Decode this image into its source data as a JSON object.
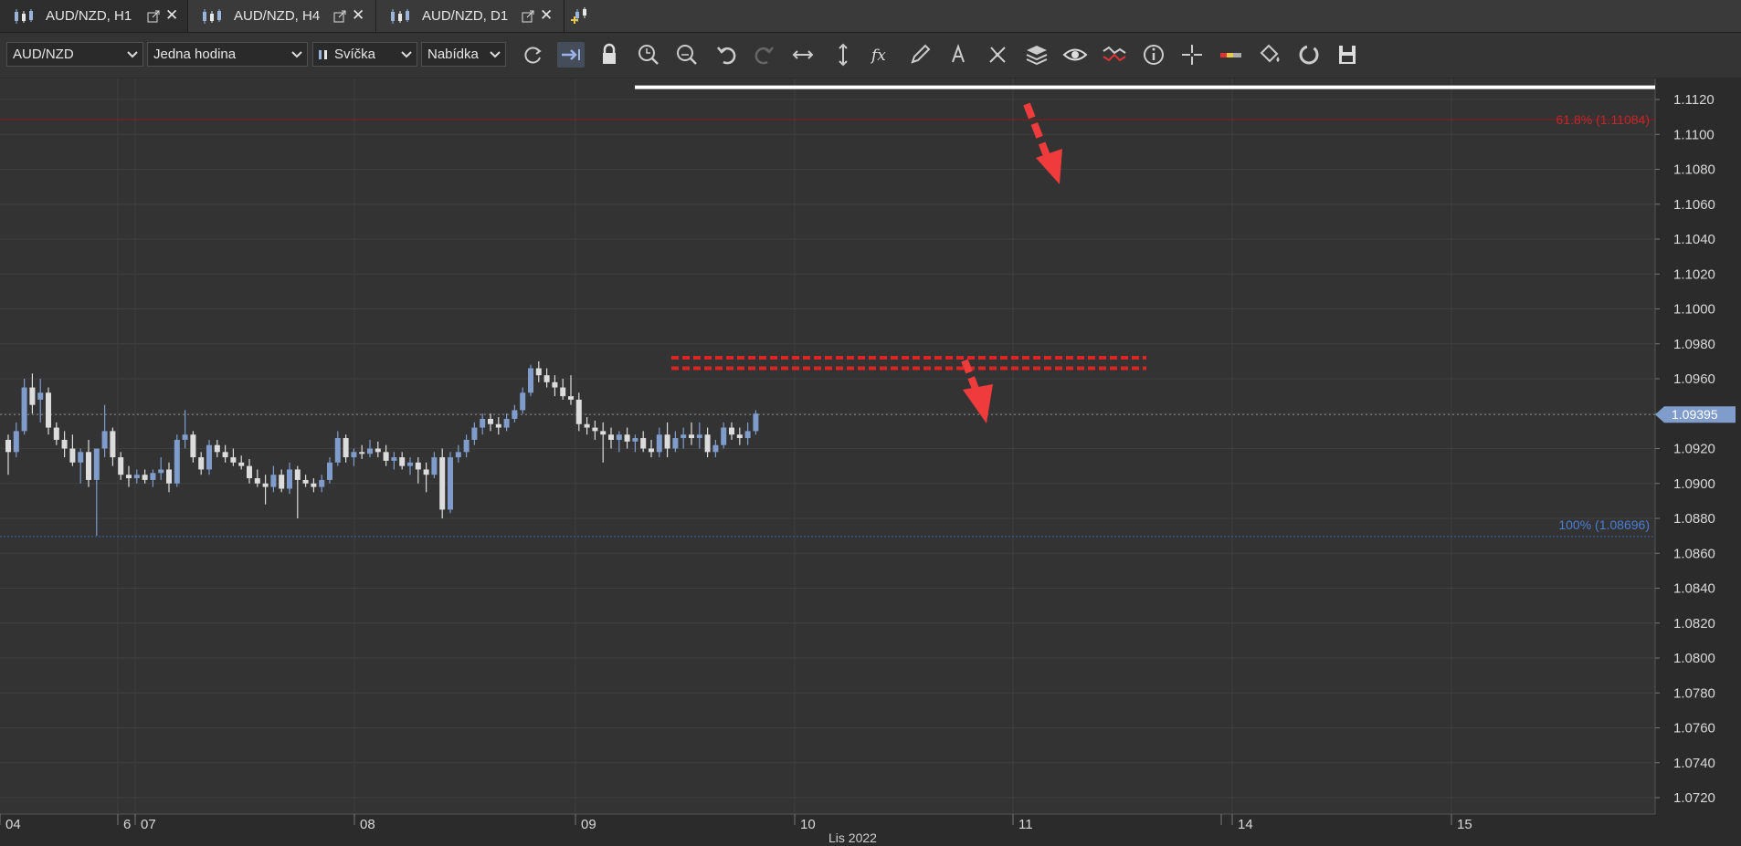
{
  "tabs": [
    {
      "label": "AUD/NZD, H1",
      "active": true
    },
    {
      "label": "AUD/NZD, H4",
      "active": false
    },
    {
      "label": "AUD/NZD, D1",
      "active": false
    }
  ],
  "toolbar": {
    "symbol": "AUD/NZD",
    "timeframe": "Jedna hodina",
    "chart_type": "Svíčka",
    "price_side": "Nabídka",
    "icons": [
      "refresh-icon",
      "autoscroll-icon",
      "lock-icon",
      "zoom-in-icon",
      "zoom-out-icon",
      "undo-icon",
      "redo-icon",
      "horizontal-scale-icon",
      "vertical-scale-icon",
      "indicators-fx-icon",
      "pencil-draw-icon",
      "text-tool-icon",
      "pattern-tool-icon",
      "layers-icon",
      "eye-visibility-icon",
      "crossed-lines-icon",
      "info-icon",
      "crosshair-icon",
      "color-bar-icon",
      "fill-bucket-icon",
      "circle-refresh-icon",
      "save-icon"
    ]
  },
  "chart_data": {
    "type": "candlestick",
    "symbol": "AUD/NZD",
    "timeframe": "H1",
    "current_price": "1.09395",
    "current_price_value": 1.09395,
    "y_range": [
      1.071,
      1.1135
    ],
    "y_ticks": [
      "1.1120",
      "1.1100",
      "1.1080",
      "1.1060",
      "1.1040",
      "1.1020",
      "1.1000",
      "1.0980",
      "1.0960",
      "1.0940",
      "1.0920",
      "1.0900",
      "1.0880",
      "1.0860",
      "1.0840",
      "1.0820",
      "1.0800",
      "1.0780",
      "1.0760",
      "1.0740",
      "1.0720"
    ],
    "x_labels": [
      "04",
      "6",
      "07",
      "08",
      "09",
      "10",
      "11",
      "14",
      "15"
    ],
    "x_caption": "Lis 2022",
    "fib_levels": [
      {
        "label": "61.8% (1.11084)",
        "value": 1.11084,
        "color": "#c1272d"
      },
      {
        "label": "100% (1.08696)",
        "value": 1.08696,
        "color": "#4a7fd4"
      }
    ],
    "resistance_zone": [
      1.0966,
      1.0972
    ],
    "upper_line_value": 1.1127,
    "candles": [
      [
        1.0925,
        1.0928,
        1.0905,
        1.0918
      ],
      [
        1.0918,
        1.0935,
        1.0915,
        1.093
      ],
      [
        1.093,
        1.096,
        1.0928,
        1.0955
      ],
      [
        1.0955,
        1.0963,
        1.094,
        1.0945
      ],
      [
        1.0948,
        1.096,
        1.0935,
        1.0952
      ],
      [
        1.0952,
        1.0955,
        1.0928,
        1.0932
      ],
      [
        1.0932,
        1.0935,
        1.0922,
        1.0925
      ],
      [
        1.0925,
        1.093,
        1.0915,
        1.092
      ],
      [
        1.092,
        1.0928,
        1.091,
        1.0912
      ],
      [
        1.0912,
        1.092,
        1.09,
        1.0918
      ],
      [
        1.0918,
        1.0925,
        1.0898,
        1.0902
      ],
      [
        1.0902,
        1.092,
        1.087,
        1.092
      ],
      [
        1.092,
        1.0945,
        1.0915,
        1.093
      ],
      [
        1.093,
        1.0932,
        1.091,
        1.0915
      ],
      [
        1.0915,
        1.0918,
        1.0902,
        1.0905
      ],
      [
        1.0905,
        1.091,
        1.0898,
        1.0903
      ],
      [
        1.0903,
        1.0908,
        1.09,
        1.0905
      ],
      [
        1.0905,
        1.0908,
        1.09,
        1.0902
      ],
      [
        1.0902,
        1.0908,
        1.0898,
        1.0906
      ],
      [
        1.0906,
        1.0915,
        1.0902,
        1.0908
      ],
      [
        1.0908,
        1.0912,
        1.0895,
        1.09
      ],
      [
        1.09,
        1.0928,
        1.0898,
        1.0925
      ],
      [
        1.0925,
        1.0942,
        1.092,
        1.0928
      ],
      [
        1.0928,
        1.093,
        1.0912,
        1.0915
      ],
      [
        1.0915,
        1.0918,
        1.0905,
        1.0908
      ],
      [
        1.0908,
        1.0925,
        1.0905,
        1.0922
      ],
      [
        1.0922,
        1.0925,
        1.0915,
        1.0918
      ],
      [
        1.0918,
        1.0922,
        1.0912,
        1.0915
      ],
      [
        1.0915,
        1.092,
        1.091,
        1.0912
      ],
      [
        1.0912,
        1.0916,
        1.0908,
        1.091
      ],
      [
        1.091,
        1.0914,
        1.09,
        1.0903
      ],
      [
        1.0903,
        1.0908,
        1.0898,
        1.09
      ],
      [
        1.09,
        1.0905,
        1.0888,
        1.0898
      ],
      [
        1.0898,
        1.091,
        1.0895,
        1.0905
      ],
      [
        1.0905,
        1.0908,
        1.0895,
        1.0897
      ],
      [
        1.0897,
        1.0912,
        1.0894,
        1.0908
      ],
      [
        1.0908,
        1.091,
        1.088,
        1.0902
      ],
      [
        1.0902,
        1.0905,
        1.0898,
        1.09
      ],
      [
        1.09,
        1.0903,
        1.0895,
        1.0898
      ],
      [
        1.0898,
        1.0905,
        1.0895,
        1.0902
      ],
      [
        1.0902,
        1.0915,
        1.09,
        1.0912
      ],
      [
        1.0912,
        1.093,
        1.091,
        1.0926
      ],
      [
        1.0926,
        1.0928,
        1.0912,
        1.0915
      ],
      [
        1.0915,
        1.092,
        1.091,
        1.0918
      ],
      [
        1.0918,
        1.0922,
        1.0914,
        1.0917
      ],
      [
        1.0917,
        1.0925,
        1.0915,
        1.092
      ],
      [
        1.092,
        1.0924,
        1.0915,
        1.0918
      ],
      [
        1.0918,
        1.0922,
        1.091,
        1.0913
      ],
      [
        1.0913,
        1.0918,
        1.0908,
        1.0915
      ],
      [
        1.0915,
        1.0918,
        1.0908,
        1.091
      ],
      [
        1.091,
        1.0915,
        1.0905,
        1.0912
      ],
      [
        1.0912,
        1.0915,
        1.09,
        1.0908
      ],
      [
        1.0908,
        1.0912,
        1.0895,
        1.0905
      ],
      [
        1.0905,
        1.0918,
        1.0903,
        1.0915
      ],
      [
        1.0915,
        1.092,
        1.088,
        1.0885
      ],
      [
        1.0885,
        1.0918,
        1.0883,
        1.0915
      ],
      [
        1.0915,
        1.0922,
        1.0912,
        1.0918
      ],
      [
        1.0918,
        1.0928,
        1.0915,
        1.0925
      ],
      [
        1.0925,
        1.0935,
        1.0922,
        1.0932
      ],
      [
        1.0932,
        1.094,
        1.0928,
        1.0937
      ],
      [
        1.0937,
        1.094,
        1.093,
        1.0934
      ],
      [
        1.0934,
        1.0938,
        1.0928,
        1.0932
      ],
      [
        1.0932,
        1.094,
        1.093,
        1.0937
      ],
      [
        1.0937,
        1.0945,
        1.0935,
        1.0942
      ],
      [
        1.0942,
        1.0955,
        1.094,
        1.0952
      ],
      [
        1.0952,
        1.0968,
        1.095,
        1.0966
      ],
      [
        1.0966,
        1.097,
        1.0958,
        1.0962
      ],
      [
        1.0962,
        1.0966,
        1.0955,
        1.0958
      ],
      [
        1.0958,
        1.0962,
        1.095,
        1.0955
      ],
      [
        1.0955,
        1.096,
        1.0948,
        1.095
      ],
      [
        1.095,
        1.0962,
        1.0945,
        1.0948
      ],
      [
        1.0948,
        1.0952,
        1.093,
        1.0934
      ],
      [
        1.0934,
        1.0938,
        1.0928,
        1.0932
      ],
      [
        1.0932,
        1.0936,
        1.0925,
        1.093
      ],
      [
        1.093,
        1.0935,
        1.0912,
        1.0928
      ],
      [
        1.0928,
        1.0932,
        1.092,
        1.0925
      ],
      [
        1.0925,
        1.093,
        1.0918,
        1.0928
      ],
      [
        1.0928,
        1.0932,
        1.092,
        1.0924
      ],
      [
        1.0924,
        1.0928,
        1.0918,
        1.0926
      ],
      [
        1.0926,
        1.093,
        1.0918,
        1.092
      ],
      [
        1.092,
        1.0925,
        1.0915,
        1.0918
      ],
      [
        1.0918,
        1.0932,
        1.0915,
        1.0928
      ],
      [
        1.0928,
        1.0935,
        1.0915,
        1.092
      ],
      [
        1.092,
        1.093,
        1.0918,
        1.0926
      ],
      [
        1.0926,
        1.0932,
        1.092,
        1.0928
      ],
      [
        1.0928,
        1.0935,
        1.0922,
        1.0926
      ],
      [
        1.0926,
        1.0935,
        1.092,
        1.0928
      ],
      [
        1.0928,
        1.0932,
        1.0915,
        1.0918
      ],
      [
        1.0918,
        1.0925,
        1.0915,
        1.0922
      ],
      [
        1.0922,
        1.0935,
        1.092,
        1.0932
      ],
      [
        1.0932,
        1.0935,
        1.0925,
        1.0928
      ],
      [
        1.0928,
        1.0932,
        1.0922,
        1.0926
      ],
      [
        1.0926,
        1.0935,
        1.0922,
        1.093
      ],
      [
        1.093,
        1.0942,
        1.0928,
        1.094
      ]
    ]
  }
}
